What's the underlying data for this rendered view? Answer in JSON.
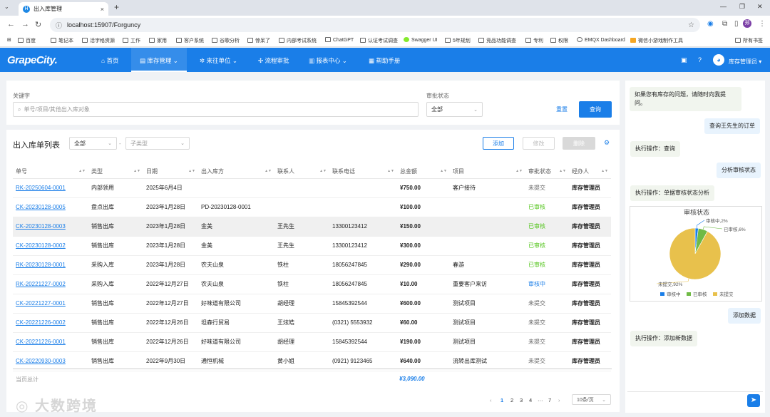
{
  "browser": {
    "tab_title": "出入库管理",
    "tab_icon": "H",
    "url": "localhost:15907/Forguncy",
    "profile": "郑",
    "bookmarks": [
      "百度",
      "笔记本",
      "活字格资源",
      "工作",
      "家用",
      "客户系统",
      "谷歌分析",
      "惊呆了",
      "内部考试系统",
      "ChatGPT",
      "认证考试调查",
      "Swagger UI",
      "5年规划",
      "竞品功能调查",
      "专利",
      "权限",
      "EMQX Dashboard",
      "微信小游戏制作工具"
    ],
    "bookmarks_right": "所有书签"
  },
  "app": {
    "logo": "GrapeCity.",
    "menu": [
      "首页",
      "库存管理",
      "来往单位",
      "流程审批",
      "报表中心",
      "帮助手册"
    ],
    "user": "库存管理员"
  },
  "search": {
    "keyword_label": "关键字",
    "keyword_placeholder": "单号/项目/其他出入库对象",
    "status_label": "审批状态",
    "status_value": "全部",
    "reset": "重置",
    "query": "查询"
  },
  "list": {
    "title": "出入库单列表",
    "type_filter": "全部",
    "separator": "-",
    "subtype_placeholder": "子类型",
    "add": "添加",
    "edit": "修改",
    "delete": "删除",
    "columns": [
      "单号",
      "类型",
      "日期",
      "出入库方",
      "联系人",
      "联系电话",
      "总金额",
      "项目",
      "审批状态",
      "经办人"
    ],
    "rows": [
      [
        "RK-20250604-0001",
        "内部领用",
        "2025年6月4日",
        "",
        "",
        "",
        "¥750.00",
        "客户接待",
        "未提交",
        "库存管理员"
      ],
      [
        "CK-20230128-0005",
        "盘点出库",
        "2023年1月28日",
        "PD-20230128-0001",
        "",
        "",
        "¥100.00",
        "",
        "已审核",
        "库存管理员"
      ],
      [
        "CK-20230128-0003",
        "销售出库",
        "2023年1月28日",
        "金美",
        "王先生",
        "13300123412",
        "¥150.00",
        "",
        "已审核",
        "库存管理员"
      ],
      [
        "CK-20230128-0002",
        "销售出库",
        "2023年1月28日",
        "金美",
        "王先生",
        "13300123412",
        "¥300.00",
        "",
        "已审核",
        "库存管理员"
      ],
      [
        "RK-20230128-0001",
        "采购入库",
        "2023年1月28日",
        "农夫山泉",
        "铁柱",
        "18056247845",
        "¥290.00",
        "春游",
        "已审核",
        "库存管理员"
      ],
      [
        "RK-20221227-0002",
        "采购入库",
        "2022年12月27日",
        "农夫山泉",
        "铁柱",
        "18056247845",
        "¥10.00",
        "重要客户来访",
        "审核中",
        "库存管理员"
      ],
      [
        "CK-20221227-0001",
        "销售出库",
        "2022年12月27日",
        "好味道有限公司",
        "胡经理",
        "15845392544",
        "¥600.00",
        "测试项目",
        "未提交",
        "库存管理员"
      ],
      [
        "CK-20221226-0002",
        "销售出库",
        "2022年12月26日",
        "坦森行贸易",
        "王炫皓",
        "(0321) 5553932",
        "¥60.00",
        "测试项目",
        "未提交",
        "库存管理员"
      ],
      [
        "CK-20221226-0001",
        "销售出库",
        "2022年12月26日",
        "好味道有限公司",
        "胡经理",
        "15845392544",
        "¥190.00",
        "测试项目",
        "未提交",
        "库存管理员"
      ],
      [
        "CK-20220930-0003",
        "销售出库",
        "2022年9月30日",
        "通恒机械",
        "黄小姐",
        "(0921) 9123465",
        "¥640.00",
        "流转出库测试",
        "未提交",
        "库存管理员"
      ]
    ],
    "total_label": "当页总计",
    "total_value": "¥3,090.00",
    "pages": [
      "1",
      "2",
      "3",
      "4",
      "···",
      "7"
    ],
    "page_size": "10条/页"
  },
  "chat": {
    "messages": [
      {
        "role": "bot",
        "text": "如果您有库存的问题，请随时向我提问。"
      },
      {
        "role": "user",
        "text": "查询王先生的订单"
      },
      {
        "role": "bot",
        "text": "执行操作：查询"
      },
      {
        "role": "user",
        "text": "分析审核状态"
      },
      {
        "role": "bot",
        "text": "执行操作：单据审核状态分析"
      },
      {
        "role": "user",
        "text": "添加数据"
      },
      {
        "role": "bot",
        "text": "执行操作：添加新数据"
      }
    ]
  },
  "chart_data": {
    "type": "pie",
    "title": "审核状态",
    "slices": [
      {
        "name": "审核中",
        "value": 2,
        "label": "审核中,2%",
        "color": "#1a7ee8"
      },
      {
        "name": "已审核",
        "value": 6,
        "label": "已审核,6%",
        "color": "#6fba45"
      },
      {
        "name": "未提交",
        "value": 92,
        "label": "未提交,92%",
        "color": "#e8c14c"
      }
    ],
    "legend": [
      "审核中",
      "已审核",
      "未提交"
    ],
    "legend_position": "bottom"
  },
  "watermark": "大数跨境"
}
